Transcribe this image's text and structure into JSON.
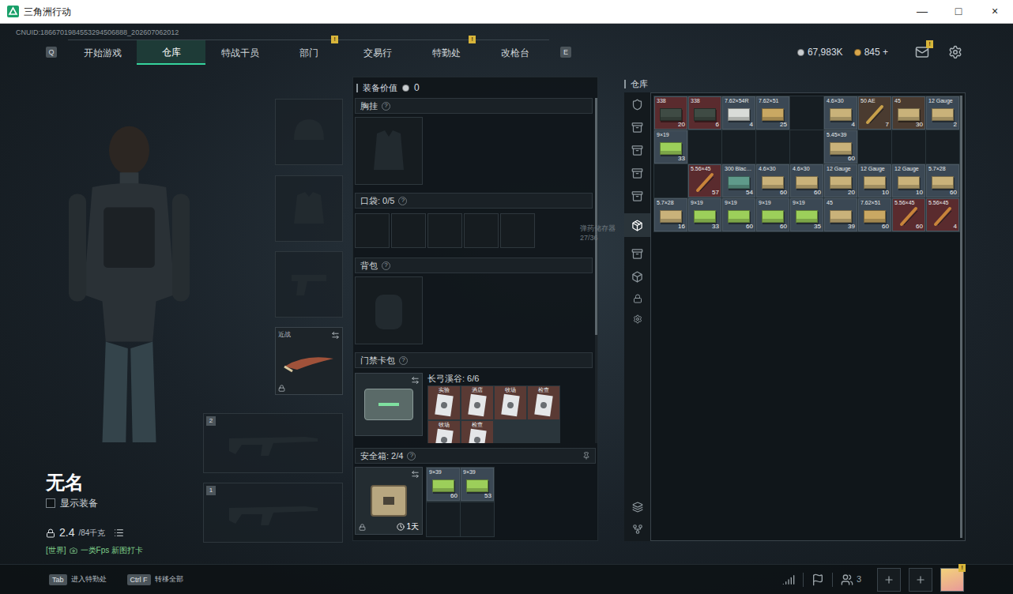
{
  "window": {
    "title": "三角洲行动",
    "controls": [
      "—",
      "□",
      "×"
    ]
  },
  "uid": "CNUID:1866701984553294506888_202607062012",
  "nav": {
    "left_key": "Q",
    "right_key": "E",
    "tabs": [
      {
        "label": "开始游戏",
        "selected": false,
        "badge": ""
      },
      {
        "label": "仓库",
        "selected": true,
        "badge": ""
      },
      {
        "label": "特战干员",
        "selected": false,
        "badge": ""
      },
      {
        "label": "部门",
        "selected": false,
        "badge": "!"
      },
      {
        "label": "交易行",
        "selected": false,
        "badge": ""
      },
      {
        "label": "特勤处",
        "selected": false,
        "badge": "!"
      },
      {
        "label": "改枪台",
        "selected": false,
        "badge": ""
      }
    ]
  },
  "currency": [
    {
      "value": "67,983K",
      "color": "#c9cdd0"
    },
    {
      "value": "845 +",
      "color": "#d9a64a"
    }
  ],
  "mail_badge": "!",
  "character": {
    "name": "无名",
    "show_equipment": {
      "label": "显示装备",
      "checked": false
    },
    "weight": "2.4",
    "weight_max": "/84千克"
  },
  "chat": {
    "channel": "[世界]",
    "message": "一类Fps 新图打卡"
  },
  "slots": {
    "melee_label": "近战",
    "weapons": [
      {
        "index": "2"
      },
      {
        "index": "1"
      }
    ]
  },
  "tooltip": {
    "label": "弹药储存器",
    "value": "27/36"
  },
  "loadout": {
    "title": "装备价值",
    "value": "0",
    "help": "?",
    "chest": "胸挂",
    "pocket": {
      "label": "口袋: 0/5",
      "slots": 5
    },
    "backpack": "背包",
    "card_pack": {
      "label": "门禁卡包",
      "map": "长弓溪谷: 6/6",
      "cards": [
        "实验",
        "酒店",
        "牧场",
        "检查",
        "牧场",
        "检查"
      ]
    },
    "safe": {
      "label": "安全箱: 2/4",
      "timer": "1天",
      "items": [
        {
          "caliber": "9×39",
          "count": "60"
        },
        {
          "caliber": "9×39",
          "count": "53"
        }
      ]
    }
  },
  "warehouse": {
    "title": "仓库",
    "rows": [
      [
        {
          "kind": "box",
          "caliber": "338",
          "count": "20",
          "color": "#3f4b44",
          "bg": "#5a2b2e"
        },
        {
          "kind": "box",
          "caliber": "338",
          "count": "6",
          "color": "#3f4b44",
          "bg": "#5a2b2e"
        },
        {
          "kind": "box",
          "caliber": "7.62×54R",
          "count": "4",
          "color": "#d9dcd8",
          "bg": "#3b4854"
        },
        {
          "kind": "box",
          "caliber": "7.62×51",
          "count": "25",
          "color": "#c9a863",
          "bg": "#3b4854"
        },
        {
          "kind": "empty",
          "caliber": "",
          "count": "",
          "color": "",
          "bg": ""
        },
        {
          "kind": "box",
          "caliber": "4.6×30",
          "count": "4",
          "color": "#c9b27a",
          "bg": "#3b4854"
        },
        {
          "kind": "round",
          "caliber": "50 AE",
          "count": "7",
          "color": "#c8a04a",
          "bg": "#4a3b30"
        },
        {
          "kind": "box",
          "caliber": "45",
          "count": "30",
          "color": "#c9b27a",
          "bg": "#4a3b30"
        },
        {
          "kind": "box",
          "caliber": "12 Gauge",
          "count": "2",
          "color": "#c9b27a",
          "bg": "#3b4854"
        }
      ],
      [
        {
          "kind": "box",
          "caliber": "9×19",
          "count": "33",
          "color": "#9ccf5a",
          "bg": "#3b4854"
        },
        {
          "kind": "empty",
          "caliber": "",
          "count": "",
          "color": "",
          "bg": ""
        },
        {
          "kind": "empty",
          "caliber": "",
          "count": "",
          "color": "",
          "bg": ""
        },
        {
          "kind": "empty",
          "caliber": "",
          "count": "",
          "color": "",
          "bg": ""
        },
        {
          "kind": "empty",
          "caliber": "",
          "count": "",
          "color": "",
          "bg": ""
        },
        {
          "kind": "box",
          "caliber": "5.45×39",
          "count": "60",
          "color": "#c9b27a",
          "bg": "#3b4854"
        },
        {
          "kind": "empty",
          "caliber": "",
          "count": "",
          "color": "",
          "bg": ""
        },
        {
          "kind": "empty",
          "caliber": "",
          "count": "",
          "color": "",
          "bg": ""
        },
        {
          "kind": "empty",
          "caliber": "",
          "count": "",
          "color": "",
          "bg": ""
        }
      ],
      [
        {
          "kind": "empty",
          "caliber": "",
          "count": "",
          "color": "",
          "bg": ""
        },
        {
          "kind": "round",
          "caliber": "5.56×45",
          "count": "57",
          "color": "#c8843a",
          "bg": "#5a2b2e"
        },
        {
          "kind": "box",
          "caliber": "300 Blac…",
          "count": "54",
          "color": "#5f9a8a",
          "bg": "#3b4854"
        },
        {
          "kind": "box",
          "caliber": "4.6×30",
          "count": "60",
          "color": "#c9b27a",
          "bg": "#3b4854"
        },
        {
          "kind": "box",
          "caliber": "4.6×30",
          "count": "60",
          "color": "#c9b27a",
          "bg": "#3b4854"
        },
        {
          "kind": "box",
          "caliber": "12 Gauge",
          "count": "20",
          "color": "#c9b27a",
          "bg": "#3b4854"
        },
        {
          "kind": "box",
          "caliber": "12 Gauge",
          "count": "10",
          "color": "#c9b27a",
          "bg": "#3b4854"
        },
        {
          "kind": "box",
          "caliber": "12 Gauge",
          "count": "10",
          "color": "#c9b27a",
          "bg": "#3b4854"
        },
        {
          "kind": "box",
          "caliber": "5.7×28",
          "count": "60",
          "color": "#c9b27a",
          "bg": "#3b4854"
        }
      ],
      [
        {
          "kind": "box",
          "caliber": "5.7×28",
          "count": "16",
          "color": "#c9b27a",
          "bg": "#3b4854"
        },
        {
          "kind": "box",
          "caliber": "9×19",
          "count": "33",
          "color": "#9ccf5a",
          "bg": "#3b4854"
        },
        {
          "kind": "box",
          "caliber": "9×19",
          "count": "60",
          "color": "#9ccf5a",
          "bg": "#3b4854"
        },
        {
          "kind": "box",
          "caliber": "9×19",
          "count": "60",
          "color": "#9ccf5a",
          "bg": "#3b4854"
        },
        {
          "kind": "box",
          "caliber": "9×19",
          "count": "35",
          "color": "#9ccf5a",
          "bg": "#3b4854"
        },
        {
          "kind": "box",
          "caliber": "45",
          "count": "39",
          "color": "#c9b27a",
          "bg": "#3b4854"
        },
        {
          "kind": "box",
          "caliber": "7.62×51",
          "count": "60",
          "color": "#c9a863",
          "bg": "#3b4854"
        },
        {
          "kind": "round",
          "caliber": "5.56×45",
          "count": "60",
          "color": "#c8843a",
          "bg": "#5a2b2e"
        },
        {
          "kind": "round",
          "caliber": "5.56×45",
          "count": "4",
          "color": "#c8843a",
          "bg": "#5a2b2e"
        }
      ]
    ]
  },
  "bottom_bar": {
    "hints": [
      {
        "key": "Tab",
        "label": "进入特勤处"
      },
      {
        "key": "Ctrl F",
        "label": "转移全部"
      }
    ],
    "friends": "3",
    "avatar_badge": "!"
  }
}
